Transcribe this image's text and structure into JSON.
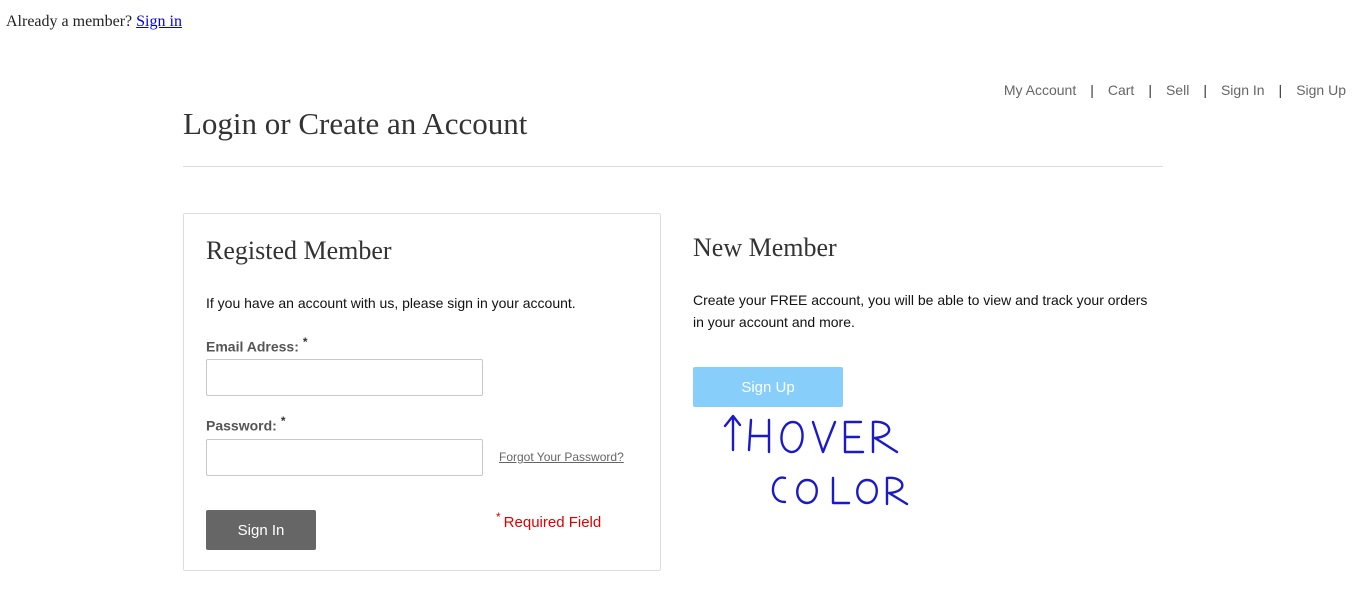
{
  "top_line": {
    "text": "Already a member?",
    "link": "Sign in"
  },
  "nav": {
    "items": [
      "My Account",
      "Cart",
      "Sell",
      "Sign In",
      "Sign Up"
    ],
    "separator": "|"
  },
  "page": {
    "title": "Login or Create an Account"
  },
  "registered": {
    "heading": "Registed Member",
    "intro": "If you have an account with us, please sign in your account.",
    "email_label": "Email Adress:",
    "password_label": "Password:",
    "required_star": "*",
    "email_value": "",
    "password_value": "",
    "forgot_link": "Forgot Your Password?",
    "signin_button": "Sign In",
    "required_note": "Required Field"
  },
  "new_member": {
    "heading": "New Member",
    "description_line1": "Create your FREE account, you will be able to view and track your orders",
    "description_line2": "in your account and more.",
    "signup_button": "Sign Up"
  },
  "annotation": {
    "line1": "HOVER",
    "line2": "COLOR",
    "ink_color": "#1a1acc"
  },
  "colors": {
    "signin_button": "#666666",
    "signup_button": "#87cefa",
    "required_text": "#dd0000",
    "link": "#0000ee"
  }
}
